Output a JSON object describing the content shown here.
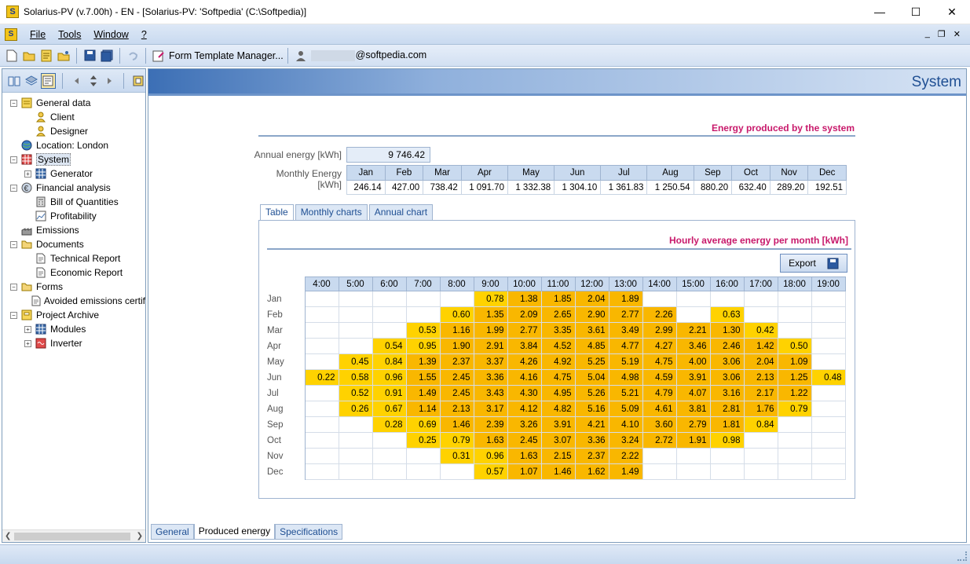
{
  "window": {
    "title": "Solarius-PV (v.7.00h) - EN - [Solarius-PV: 'Softpedia' (C:\\Softpedia)]",
    "app_icon_letter": "S",
    "minimize": "—",
    "maximize": "☐",
    "close": "✕"
  },
  "menu": {
    "items": [
      "File",
      "Tools",
      "Window",
      "?"
    ],
    "mdi_min": "_",
    "mdi_restore": "❐",
    "mdi_close": "✕"
  },
  "toolbar": {
    "form_template_label": "Form Template Manager...",
    "email_suffix": "@softpedia.com"
  },
  "tree": [
    {
      "label": "General data",
      "level": 0,
      "toggle": "−",
      "icon": "folder-data-icon"
    },
    {
      "label": "Client",
      "level": 1,
      "toggle": "",
      "icon": "user-icon"
    },
    {
      "label": "Designer",
      "level": 1,
      "toggle": "",
      "icon": "user-icon"
    },
    {
      "label": "Location: London",
      "level": 0,
      "toggle": "",
      "icon": "globe-icon"
    },
    {
      "label": "System",
      "level": 0,
      "toggle": "−",
      "icon": "system-icon",
      "selected": true
    },
    {
      "label": "Generator",
      "level": 1,
      "toggle": "+",
      "icon": "generator-icon"
    },
    {
      "label": "Financial analysis",
      "level": 0,
      "toggle": "−",
      "icon": "euro-icon"
    },
    {
      "label": "Bill of Quantities",
      "level": 1,
      "toggle": "",
      "icon": "calculator-icon"
    },
    {
      "label": "Profitability",
      "level": 1,
      "toggle": "",
      "icon": "chart-icon"
    },
    {
      "label": "Emissions",
      "level": 0,
      "toggle": "",
      "icon": "factory-icon"
    },
    {
      "label": "Documents",
      "level": 0,
      "toggle": "−",
      "icon": "folder-icon"
    },
    {
      "label": "Technical Report",
      "level": 1,
      "toggle": "",
      "icon": "document-icon"
    },
    {
      "label": "Economic Report",
      "level": 1,
      "toggle": "",
      "icon": "document-icon"
    },
    {
      "label": "Forms",
      "level": 0,
      "toggle": "−",
      "icon": "folder-icon"
    },
    {
      "label": "Avoided emissions certif",
      "level": 1,
      "toggle": "",
      "icon": "document-icon"
    },
    {
      "label": "Project Archive",
      "level": 0,
      "toggle": "−",
      "icon": "archive-icon"
    },
    {
      "label": "Modules",
      "level": 1,
      "toggle": "+",
      "icon": "module-icon"
    },
    {
      "label": "Inverter",
      "level": 1,
      "toggle": "+",
      "icon": "inverter-icon"
    }
  ],
  "main": {
    "page_title": "System",
    "energy_section_title": "Energy produced by the system",
    "annual_label": "Annual energy [kWh]",
    "annual_value": "9 746.42",
    "monthly_label_1": "Monthly Energy",
    "monthly_label_2": "[kWh]",
    "months": [
      "Jan",
      "Feb",
      "Mar",
      "Apr",
      "May",
      "Jun",
      "Jul",
      "Aug",
      "Sep",
      "Oct",
      "Nov",
      "Dec"
    ],
    "monthly_values": [
      "246.14",
      "427.00",
      "738.42",
      "1 091.70",
      "1 332.38",
      "1 304.10",
      "1 361.83",
      "1 250.54",
      "880.20",
      "632.40",
      "289.20",
      "192.51"
    ],
    "tabs": [
      "Table",
      "Monthly charts",
      "Annual chart"
    ],
    "hourly_title": "Hourly average energy per month [kWh]",
    "export_label": "Export",
    "hours": [
      "4:00",
      "5:00",
      "6:00",
      "7:00",
      "8:00",
      "9:00",
      "10:00",
      "11:00",
      "12:00",
      "13:00",
      "14:00",
      "15:00",
      "16:00",
      "17:00",
      "18:00",
      "19:00"
    ],
    "hourly": [
      [
        "",
        "",
        "",
        "",
        "",
        "0.78",
        "1.38",
        "1.85",
        "2.04",
        "1.89",
        "",
        "",
        "",
        "",
        "",
        ""
      ],
      [
        "",
        "",
        "",
        "",
        "0.60",
        "1.35",
        "2.09",
        "2.65",
        "2.90",
        "2.77",
        "2.26",
        "",
        "0.63",
        "",
        "",
        ""
      ],
      [
        "",
        "",
        "",
        "0.53",
        "1.16",
        "1.99",
        "2.77",
        "3.35",
        "3.61",
        "3.49",
        "2.99",
        "2.21",
        "1.30",
        "0.42",
        "",
        ""
      ],
      [
        "",
        "",
        "0.54",
        "0.95",
        "1.90",
        "2.91",
        "3.84",
        "4.52",
        "4.85",
        "4.77",
        "4.27",
        "3.46",
        "2.46",
        "1.42",
        "0.50",
        ""
      ],
      [
        "",
        "0.45",
        "0.84",
        "1.39",
        "2.37",
        "3.37",
        "4.26",
        "4.92",
        "5.25",
        "5.19",
        "4.75",
        "4.00",
        "3.06",
        "2.04",
        "1.09",
        ""
      ],
      [
        "0.22",
        "0.58",
        "0.96",
        "1.55",
        "2.45",
        "3.36",
        "4.16",
        "4.75",
        "5.04",
        "4.98",
        "4.59",
        "3.91",
        "3.06",
        "2.13",
        "1.25",
        "0.48"
      ],
      [
        "",
        "0.52",
        "0.91",
        "1.49",
        "2.45",
        "3.43",
        "4.30",
        "4.95",
        "5.26",
        "5.21",
        "4.79",
        "4.07",
        "3.16",
        "2.17",
        "1.22",
        ""
      ],
      [
        "",
        "0.26",
        "0.67",
        "1.14",
        "2.13",
        "3.17",
        "4.12",
        "4.82",
        "5.16",
        "5.09",
        "4.61",
        "3.81",
        "2.81",
        "1.76",
        "0.79",
        ""
      ],
      [
        "",
        "",
        "0.28",
        "0.69",
        "1.46",
        "2.39",
        "3.26",
        "3.91",
        "4.21",
        "4.10",
        "3.60",
        "2.79",
        "1.81",
        "0.84",
        "",
        ""
      ],
      [
        "",
        "",
        "",
        "0.25",
        "0.79",
        "1.63",
        "2.45",
        "3.07",
        "3.36",
        "3.24",
        "2.72",
        "1.91",
        "0.98",
        "",
        "",
        ""
      ],
      [
        "",
        "",
        "",
        "",
        "0.31",
        "0.96",
        "1.63",
        "2.15",
        "2.37",
        "2.22",
        "",
        "",
        "",
        "",
        "",
        ""
      ],
      [
        "",
        "",
        "",
        "",
        "",
        "0.57",
        "1.07",
        "1.46",
        "1.62",
        "1.49",
        "",
        "",
        "",
        "",
        "",
        ""
      ]
    ]
  },
  "bottom_tabs": [
    "General",
    "Produced energy",
    "Specifications"
  ],
  "colors": {
    "accent": "#1f4f93",
    "section_title": "#c8196b",
    "cell_hot": "#ffd200"
  }
}
